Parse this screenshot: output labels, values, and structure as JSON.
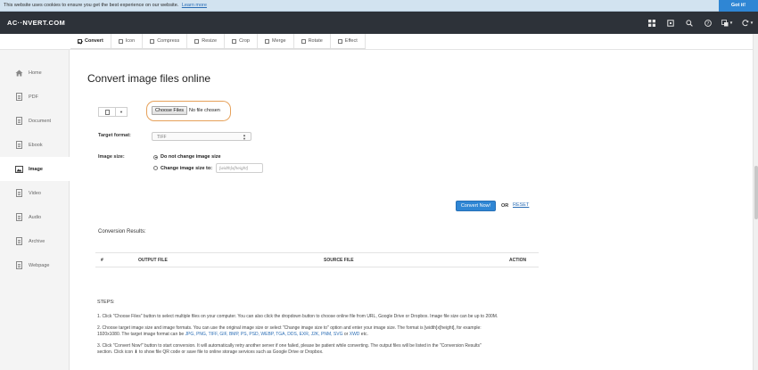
{
  "cookie": {
    "text": "This website uses cookies to ensure you get the best experience on our website.",
    "learn_more": "Learn more",
    "got_it": "Got it!"
  },
  "header": {
    "logo": "AC··NVERT.COM",
    "icons": [
      "apps-icon",
      "cube-icon",
      "search-icon",
      "help-icon",
      "language-icon",
      "refresh-icon"
    ]
  },
  "tabs": [
    {
      "label": "Convert",
      "active": true
    },
    {
      "label": "Icon",
      "active": false
    },
    {
      "label": "Compress",
      "active": false
    },
    {
      "label": "Resize",
      "active": false
    },
    {
      "label": "Crop",
      "active": false
    },
    {
      "label": "Merge",
      "active": false
    },
    {
      "label": "Rotate",
      "active": false
    },
    {
      "label": "Effect",
      "active": false
    }
  ],
  "sidebar": {
    "items": [
      {
        "label": "Home",
        "icon": "home-icon"
      },
      {
        "label": "PDF",
        "icon": "pdf-icon"
      },
      {
        "label": "Document",
        "icon": "document-icon"
      },
      {
        "label": "Ebook",
        "icon": "ebook-icon"
      },
      {
        "label": "Image",
        "icon": "image-icon"
      },
      {
        "label": "Video",
        "icon": "video-icon"
      },
      {
        "label": "Audio",
        "icon": "audio-icon"
      },
      {
        "label": "Archive",
        "icon": "archive-icon"
      },
      {
        "label": "Webpage",
        "icon": "webpage-icon"
      }
    ],
    "active": "Image"
  },
  "main": {
    "title": "Convert image files online",
    "choose_files": "Choose Files",
    "no_file": "No file chosen",
    "target_format_label": "Target format:",
    "target_format_value": "TIFF",
    "image_size_label": "Image size:",
    "opt_no_change": "Do not change image size",
    "opt_change": "Change image size to:",
    "size_placeholder": "[width]x[height]",
    "convert_button": "Convert Now!",
    "or": "OR",
    "reset": "RESET",
    "results_title": "Conversion Results:",
    "columns": [
      "#",
      "OUTPUT FILE",
      "SOURCE FILE",
      "ACTION"
    ]
  },
  "steps": {
    "heading": "STEPS:",
    "step1": "1. Click \"Choose Files\" button to select multiple files on your computer. You can also click the dropdown button to choose online file from URL, Google Drive or Dropbox. Image file size can be up to 200M.",
    "step2a": "2. Choose target image size and image formats. You can use the original image size or select \"Change image size to\" option and enter your image size. The format is [width]x[height], for example:",
    "step2b_pre": "1920x1080. The target image format can be ",
    "step2b_formats": "JPG, PNG, TIFF, GIF, BMP, PS, PSD, WEBP, TGA, DDS, EXR, J2K, PNM, SVG",
    "step2b_or": " or ",
    "step2b_last": "XWD",
    "step2b_post": " etc.",
    "step3a": "3. Click \"Convert Now!\" button to start conversion. It will automatically retry another server if one failed, please be patient while converting. The output files will be listed in the \"Conversion Results\"",
    "step3b": "section. Click icon ⬇ to show file QR code or save file to online storage services such as Google Drive or Dropbox."
  }
}
